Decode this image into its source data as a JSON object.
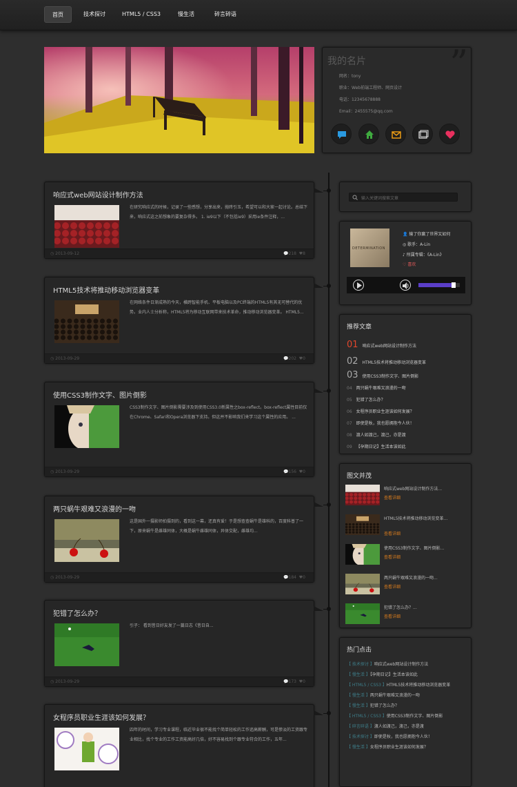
{
  "nav": {
    "items": [
      "首页",
      "技术探讨",
      "HTML5 / CSS3",
      "慢生活",
      "碎言碎语"
    ]
  },
  "card": {
    "title": "我的名片",
    "name": "网名：tony",
    "job": "职业：Web前端工程师、网页设计",
    "phone": "电话：12345678888",
    "email": "Email：2455575@qq.com"
  },
  "social_icons": [
    "chat-icon",
    "home-icon",
    "mail-icon",
    "gallery-icon",
    "heart-icon"
  ],
  "search": {
    "placeholder": "输入关键词搜索文章"
  },
  "music": {
    "cover_text": "DETERMINATION",
    "song": "输了你赢了世界又如何",
    "singer": "歌手：A-Lin",
    "album": "所属专辑：《A-Lin》",
    "like": "喜欢",
    "progress": 0.0,
    "volume": 0.85
  },
  "posts": [
    {
      "title": "响应式web网站设计制作方法",
      "text": "在研究响应式的时候，记录了一些感想，分享出来，抛砖引玉，希望可以和大家一起讨论。总结下来，响应式这之前想象的要复杂得多。 1. ie9以下（不包括ie9）采用ie条件注释，...",
      "date": "2013-09-12",
      "comments": "218",
      "likes": "8",
      "thumb": "cinema"
    },
    {
      "title": "HTML5技术将推动移动浏览器变革",
      "text": "在网络条件日渐成熟的今天，横跨智能手机、平板电脑以及PC终端的HTML5有其无可替代的优势。业内人士分析称，HTML5将为移动互联网带来技术革命，推动移动浏览器变革。 HTML5...",
      "date": "2013-09-29",
      "comments": "202",
      "likes": "0",
      "thumb": "conference"
    },
    {
      "title": "使用CSS3制作文字、图片倒影",
      "text": "CSS3制作文字、图片倒影需要涉及到使用CSS3.0新属性之box-reflect。box-reflect属性目前仅在Chrome、Safari和Opera浏览器下支持。但这并不影响我们来学习这个属性的应用。 ...",
      "date": "2013-09-29",
      "comments": "156",
      "likes": "0",
      "thumb": "face"
    },
    {
      "title": "两只蜗牛艰难又浪漫的一吻",
      "text": "这是国外一摄影师拍摄到的，看到这一幕，还真有爱！于是想查查蜗牛是雄科的，百度科普了一下，原来蜗牛是雌雄同体，大概是蜗牛雌雄同体，异体交配，雌雄均...",
      "date": "2013-09-29",
      "comments": "184",
      "likes": "0",
      "thumb": "cherry"
    },
    {
      "title": "犯错了怎么办？",
      "text": "引子： 看到昔日好友发了一篇日志《昔日自...",
      "date": "2013-09-29",
      "comments": "173",
      "likes": "0",
      "thumb": "soccer"
    },
    {
      "title": "女程序员职业生涯该如何发展？",
      "text": "四年的时间，学习专业课程，临近毕业很不能找个简单轻松的工作追高薪酬，可是惨淡的工资跟专业相比，找个专业的工作工资能高好几倍，好不容易找到个跟专业符合的工作，五年...",
      "date": "",
      "comments": "",
      "likes": "",
      "thumb": "clock"
    }
  ],
  "recommend": {
    "title": "推荐文章",
    "items": [
      {
        "num": "01",
        "label": "响应式web网站设计制作方法"
      },
      {
        "num": "02",
        "label": "HTML5技术将推动移动浏览器变革"
      },
      {
        "num": "03",
        "label": "使用CSS3制作文字、图片倒影"
      },
      {
        "num": "04",
        "label": "两只蜗牛艰难又浪漫的一吻"
      },
      {
        "num": "05",
        "label": "犯错了怎么办？"
      },
      {
        "num": "06",
        "label": "女程序员职业生涯该如何发展？"
      },
      {
        "num": "07",
        "label": "即使是秋，我也愿拥抱今人伙！"
      },
      {
        "num": "08",
        "label": "渡人如渡己，渡己，亦是渡"
      },
      {
        "num": "09",
        "label": "【孕期日记】生活本该如此"
      }
    ]
  },
  "pictures": {
    "title": "图文并茂",
    "more": "查看详细",
    "items": [
      {
        "label": "响应式web网站设计制作方法...",
        "thumb": "cinema"
      },
      {
        "label": "HTML5技术将推动移动浏览变革...",
        "thumb": "conference"
      },
      {
        "label": "使用CSS3制作文字、图片倒影...",
        "thumb": "face"
      },
      {
        "label": "两只蜗牛艰难又浪漫的一吻...",
        "thumb": "cherry"
      },
      {
        "label": "犯错了怎么办？...",
        "thumb": "soccer"
      }
    ]
  },
  "hot": {
    "title": "热门点击",
    "items": [
      {
        "cat": "【 技术探讨 】",
        "label": "响应式web网站设计制作方法"
      },
      {
        "cat": "【 慢生活 】",
        "label": "【孕期日记】生活本该如此"
      },
      {
        "cat": "【 HTML5 / CSS3 】",
        "label": "HTML5技术将推动移动浏览器变革"
      },
      {
        "cat": "【 慢生活 】",
        "label": "两只蜗牛艰难又浪漫的一吻"
      },
      {
        "cat": "【 慢生活 】",
        "label": "犯错了怎么办？"
      },
      {
        "cat": "【 HTML5 / CSS3 】",
        "label": "使用CSS3制作文字、图片倒影"
      },
      {
        "cat": "【 碎言碎语 】",
        "label": "渡人如渡己，渡己，亦是渡"
      },
      {
        "cat": "【 技术探讨 】",
        "label": "即使是秋，我也愿拥抱今人伙！"
      },
      {
        "cat": "【 慢生活 】",
        "label": "女程序员职业生涯该如何发展？"
      }
    ]
  }
}
